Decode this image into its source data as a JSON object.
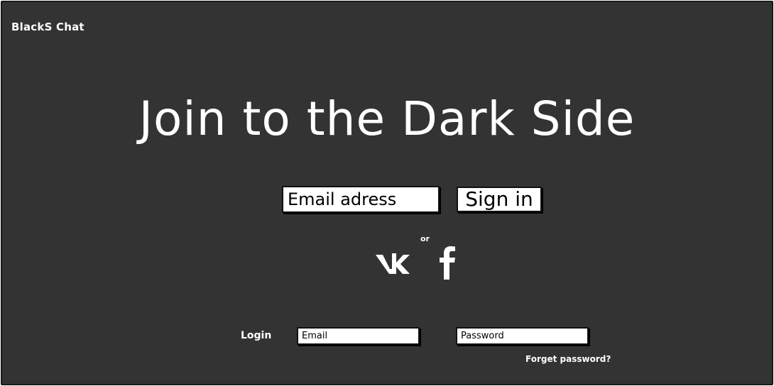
{
  "app": {
    "title": "BlackS Chat"
  },
  "hero": {
    "headline": "Join to the Dark Side"
  },
  "signup": {
    "email_placeholder": "Email adress",
    "signin_label": "Sign in"
  },
  "social": {
    "or_label": "or",
    "icons": [
      "vk-icon",
      "facebook-icon"
    ]
  },
  "login": {
    "label": "Login",
    "email_placeholder": "Email",
    "password_placeholder": "Password",
    "forgot_label": "Forget password?"
  },
  "colors": {
    "background": "#333333",
    "text": "#ffffff",
    "field": "#ffffff"
  }
}
